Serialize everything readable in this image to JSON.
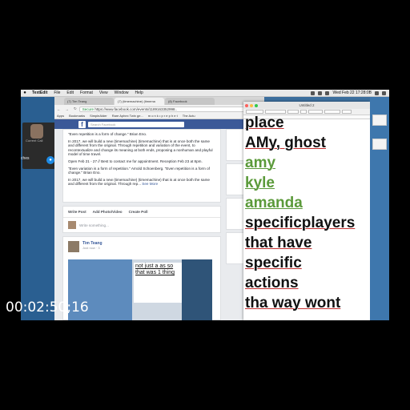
{
  "menubar": {
    "app": "TextEdit",
    "items": [
      "File",
      "Edit",
      "Format",
      "View",
      "Window",
      "Help"
    ],
    "clock": "Wed Feb 22  17:28:0B"
  },
  "call": {
    "label": "Current Call",
    "desktop_text": "ches"
  },
  "browser": {
    "tabs": [
      "(7) Tim Teang",
      "(7) (timemachine) (timema",
      "(8) Facebook"
    ],
    "url_secure": "Secure",
    "url": "https://www.facebook.com/events/1189163352998..",
    "bookmarks": [
      "Apps",
      "Bookmarks",
      "SimpleAlder",
      "Rare Aphex Twin ge...",
      "m o n k • p r e p h e t",
      "The Actu"
    ],
    "search_placeholder": "Search Facebook",
    "post1": {
      "lines": [
        "\"Even repetition is a form of change.\" Brian Eno.",
        "In 2017, we will build a new (timemachine) (timemachine) that is at once both the same and different from the original. Through repetition and variation of the event, to recontextualize and change its meaning at both ends, proposing a nonhuman and playful model of time travel.",
        "Open Feb 21 - 27 // Best to contact me for appointment. Reception Feb 23 at 8pm.",
        "\"Even variation is a form of repetition.\" Arnold Schoenberg. \"Even repetition is a form of change.\" Brian Eno.",
        "In 2017, we will build a new (timemachine) (timemachine) that is at once both the same and different from the original. Through rep..."
      ],
      "see_more": "See More"
    },
    "compose": {
      "write_post": "Write Post",
      "add_photo": "Add Photo/Video",
      "create_poll": "Create Poll",
      "placeholder": "Write something..."
    },
    "post2": {
      "author": "Tim Teang",
      "meta": "Just now · 3",
      "image_text": "not just a as so that was 1 thing"
    }
  },
  "textedit": {
    "title": "Untitled 2",
    "lines": [
      {
        "text": "place",
        "color": "#111111"
      },
      {
        "text": "AMy, ghost",
        "color": "#111111"
      },
      {
        "text": "amy",
        "color": "#5b9a3a"
      },
      {
        "text": "kyle",
        "color": "#5b9a3a"
      },
      {
        "text": "amanda",
        "color": "#5b9a3a"
      },
      {
        "text": "specificplayers",
        "color": "#111111"
      },
      {
        "text": "that have",
        "color": "#111111"
      },
      {
        "text": "specific",
        "color": "#111111"
      },
      {
        "text": "actions",
        "color": "#111111"
      },
      {
        "text": "tha way wont",
        "color": "#111111"
      }
    ]
  },
  "timecode": "00:02:50;16"
}
